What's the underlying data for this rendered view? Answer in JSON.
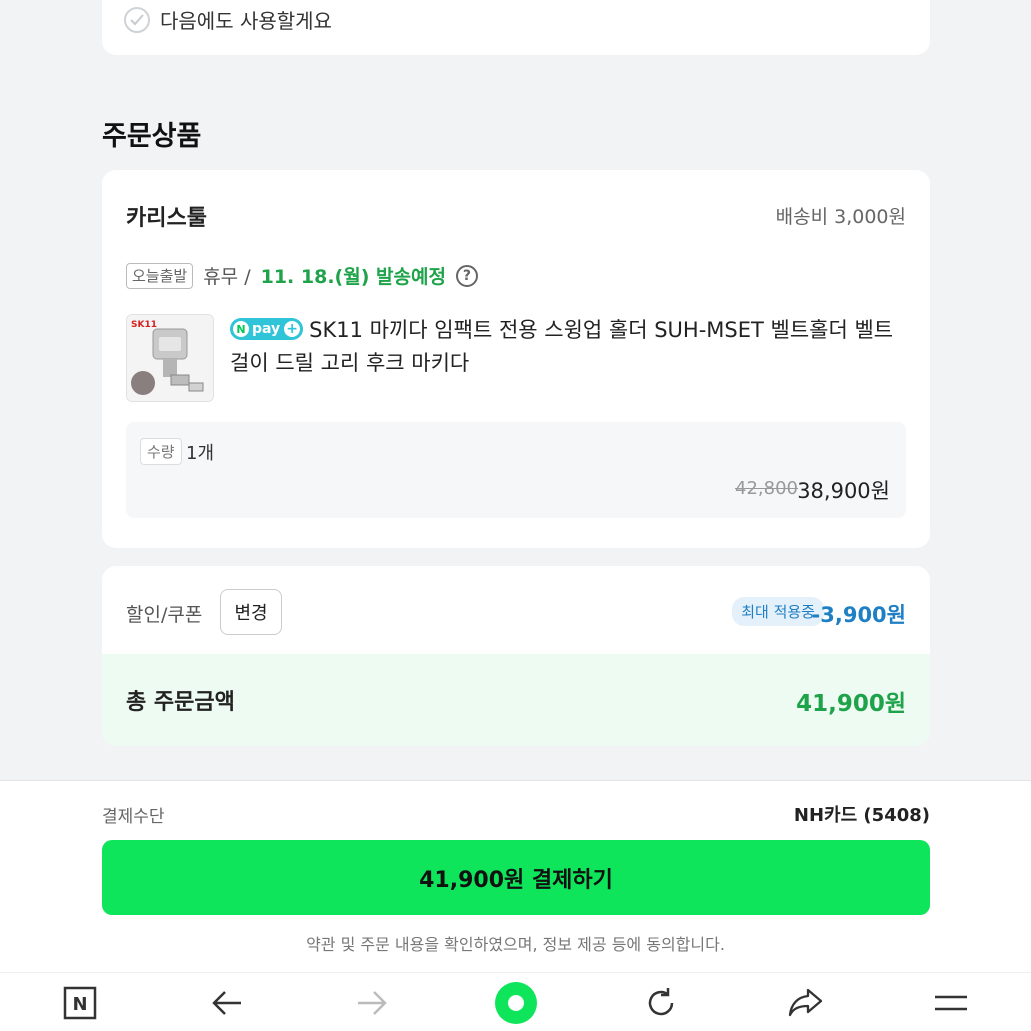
{
  "reuse": {
    "label": "다음에도 사용할게요"
  },
  "section": {
    "title": "주문상품"
  },
  "order": {
    "seller": "카리스툴",
    "shipping_fee": "배송비 3,000원",
    "today_badge": "오늘출발",
    "holiday": "휴무 /",
    "ship_date": "11. 18.(월) 발송예정",
    "help_icon_text": "?",
    "npay_badge": {
      "n": "N",
      "text": "pay",
      "plus": "+"
    },
    "product_name": "SK11 마끼다 임팩트 전용 스윙업 홀더 SUH-MSET 벨트홀더 벨트 걸이 드릴 고리 후크 마키다",
    "thumb_logo": "SK11",
    "qty_label": "수량",
    "qty_value": "1개",
    "price_original": "42,800",
    "price_final": "38,900원"
  },
  "discount": {
    "label": "할인/쿠폰",
    "change_button": "변경",
    "max_badge": "최대 적용중",
    "amount": "-3,900원"
  },
  "total": {
    "label": "총 주문금액",
    "amount": "41,900원"
  },
  "payment": {
    "method_label": "결제수단",
    "method_value": "NH카드 (5408)",
    "button_label": "41,900원 결제하기",
    "agree_text": "약관 및 주문 내용을 확인하였으며, 정보 제공 등에 동의합니다."
  },
  "nav": {
    "home_glyph": "N",
    "icons": [
      "naver-home-icon",
      "back-arrow-icon",
      "forward-arrow-icon",
      "green-dot-icon",
      "refresh-icon",
      "share-icon",
      "menu-icon"
    ]
  },
  "colors": {
    "accent_green": "#0ee55a",
    "text_green": "#1fa34a",
    "discount_blue": "#1f7fc4",
    "background": "#f2f3f5"
  }
}
